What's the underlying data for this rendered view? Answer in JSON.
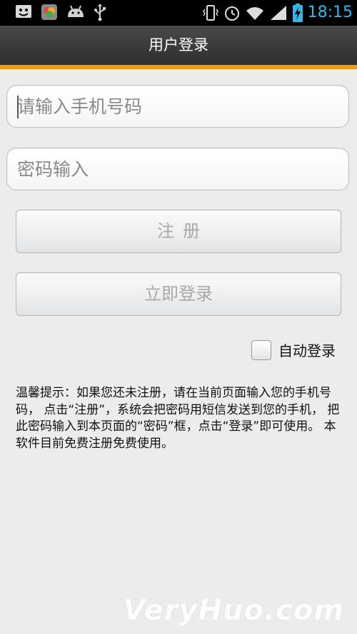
{
  "status_bar": {
    "time": "18:15",
    "icons": [
      "notification-icon",
      "photo-app-icon",
      "android-icon",
      "usb-icon",
      "vibrate-icon",
      "alarm-icon",
      "wifi-icon",
      "signal-icon",
      "battery-charging-icon"
    ],
    "time_color": "#33b5e5"
  },
  "header": {
    "title": "用户登录",
    "accent_color": "#f29a10"
  },
  "form": {
    "phone_placeholder": "请输入手机号码",
    "phone_value": "",
    "password_placeholder": "密码输入",
    "password_value": "",
    "register_label": "注册",
    "login_label": "立即登录",
    "auto_login_label": "自动登录",
    "auto_login_checked": false
  },
  "tip": {
    "text": "温馨提示：如果您还未注册，请在当前页面输入您的手机号码， 点击“注册”，系统会把密码用短信发送到您的手机， 把此密码输入到本页面的“密码”框，点击“登录”即可使用。 本软件目前免费注册免费使用。"
  },
  "watermark": "VeryHuo.com"
}
